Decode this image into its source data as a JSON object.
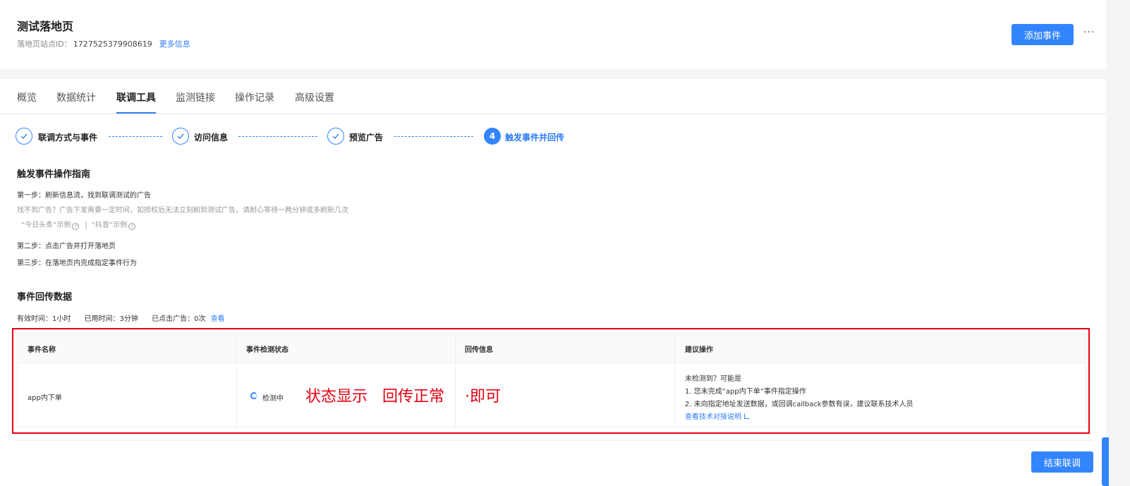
{
  "header": {
    "title": "测试落地页",
    "site_id_label": "落地页站点ID：",
    "site_id_value": "1727525379908619",
    "more_info_link": "更多信息",
    "add_event_button": "添加事件",
    "more_button": "···"
  },
  "tabs": [
    {
      "label": "概览"
    },
    {
      "label": "数据统计"
    },
    {
      "label": "联调工具"
    },
    {
      "label": "监测链接"
    },
    {
      "label": "操作记录"
    },
    {
      "label": "高级设置"
    }
  ],
  "active_tab": "联调工具",
  "steps": [
    {
      "label": "联调方式与事件",
      "status": "done"
    },
    {
      "label": "访问信息",
      "status": "done"
    },
    {
      "label": "预览广告",
      "status": "done"
    },
    {
      "label": "触发事件并回传",
      "status": "current",
      "number": "4"
    }
  ],
  "guide": {
    "title": "触发事件操作指南",
    "step1": "第一步：刷新信息流，找到联调测试的广告",
    "step1_hint": "找不到广告？广告下发需要一定时间，如授权后无法立刻刷到测试广告，请耐心等待一两分钟或多刷新几次",
    "example1": "“今日头条”示例",
    "example2": "“抖音”示例",
    "separator": "|",
    "step2": "第二步：点击广告并打开落地页",
    "step3": "第三步：在落地页内完成指定事件行为"
  },
  "event_data": {
    "title": "事件回传数据",
    "valid_time": "有效时间：1小时",
    "used_time": "已用时间：3分钟",
    "clicked_ads": "已点击广告：0次",
    "view_link": "查看"
  },
  "table": {
    "headers": [
      "事件名称",
      "事件检测状态",
      "回传信息",
      "建议操作"
    ],
    "row": {
      "event_name": "app内下单",
      "status": "检测中",
      "suggestion_title": "未检测到？可能是",
      "suggestion_1": "1. 您未完成“app内下单”事件指定操作",
      "suggestion_2": "2. 未向指定地址发送数据，或回调callback参数有误，建议联系技术人员",
      "suggestion_link": "查看技术对接说明"
    }
  },
  "annotations": {
    "text1": "状态显示",
    "text2": "回传正常",
    "text3": "·即可",
    "color": "#e60012"
  },
  "footer": {
    "end_button": "结束联调"
  },
  "colors": {
    "primary": "#3385ff",
    "link": "#2f7cf6"
  }
}
